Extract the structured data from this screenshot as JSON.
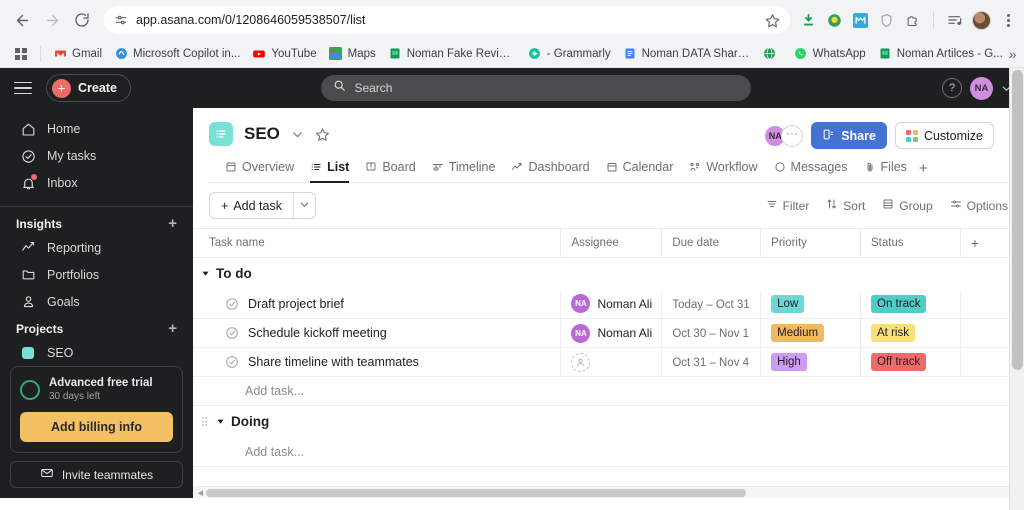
{
  "browser": {
    "back_icon": "back-arrow-icon",
    "forward_icon": "forward-arrow-icon",
    "reload_icon": "reload-icon",
    "url": "app.asana.com/0/1208646059538507/list",
    "site_settings_icon": "site-settings-icon",
    "bookmark_star_icon": "star-icon",
    "toolbar_icons": [
      "download-icon",
      "extension-green-icon",
      "extension-blue-icon",
      "shield-icon",
      "extension-outline-icon"
    ],
    "split_screen_icon": "split-screen-icon",
    "profile_icon": "profile-avatar",
    "menu_icon": "kebab-menu-icon",
    "apps_icon": "apps-grid-icon",
    "overflow_label": "»",
    "bookmarks": [
      {
        "label": "Gmail",
        "icon": "gmail-icon"
      },
      {
        "label": "Microsoft Copilot in...",
        "icon": "copilot-icon"
      },
      {
        "label": "YouTube",
        "icon": "youtube-icon"
      },
      {
        "label": "Maps",
        "icon": "maps-icon"
      },
      {
        "label": "Noman Fake Review...",
        "icon": "sheets-icon"
      },
      {
        "label": "- Grammarly",
        "icon": "grammarly-icon"
      },
      {
        "label": "Noman DATA Sharin...",
        "icon": "docs-icon"
      },
      {
        "label": "",
        "icon": "globe-icon"
      },
      {
        "label": "WhatsApp",
        "icon": "whatsapp-icon"
      },
      {
        "label": "Noman Artilces - G...",
        "icon": "sheets-icon"
      }
    ]
  },
  "topbar": {
    "menu_icon": "hamburger-menu-icon",
    "create_label": "Create",
    "search_placeholder": "Search",
    "search_icon": "search-icon",
    "help_label": "?",
    "avatar_initials": "NA"
  },
  "sidebar": {
    "items": [
      {
        "label": "Home",
        "icon": "home-icon"
      },
      {
        "label": "My tasks",
        "icon": "check-circle-icon"
      },
      {
        "label": "Inbox",
        "icon": "bell-icon",
        "badge": true
      }
    ],
    "insights": {
      "title": "Insights",
      "add_label": "+",
      "items": [
        {
          "label": "Reporting",
          "icon": "chart-line-icon"
        },
        {
          "label": "Portfolios",
          "icon": "folder-icon"
        },
        {
          "label": "Goals",
          "icon": "goal-icon"
        }
      ]
    },
    "projects": {
      "title": "Projects",
      "add_label": "+",
      "items": [
        {
          "label": "SEO",
          "icon": "project-dot-icon",
          "color": "#7ae0d3"
        }
      ]
    },
    "trial": {
      "title": "Advanced free trial",
      "subtitle": "30 days left",
      "billing_label": "Add billing info",
      "billing_color": "#f3c164"
    },
    "invite_label": "Invite teammates",
    "invite_icon": "envelope-icon"
  },
  "project": {
    "name": "SEO",
    "icon": "list-project-icon",
    "icon_color": "#7ae0d3",
    "chevron_icon": "chevron-down-icon",
    "star_icon": "star-outline-icon",
    "avatar_initials": "NA",
    "avatar_more": "···",
    "share_label": "Share",
    "share_icon": "share-icon",
    "share_color": "#4573d2",
    "customize_label": "Customize",
    "customize_icon": "customize-grid-icon",
    "tabs": [
      {
        "label": "Overview",
        "icon": "overview-icon",
        "active": false
      },
      {
        "label": "List",
        "icon": "list-icon",
        "active": true
      },
      {
        "label": "Board",
        "icon": "board-icon",
        "active": false
      },
      {
        "label": "Timeline",
        "icon": "timeline-icon",
        "active": false
      },
      {
        "label": "Dashboard",
        "icon": "dashboard-icon",
        "active": false
      },
      {
        "label": "Calendar",
        "icon": "calendar-icon",
        "active": false
      },
      {
        "label": "Workflow",
        "icon": "workflow-icon",
        "active": false
      },
      {
        "label": "Messages",
        "icon": "messages-icon",
        "active": false
      },
      {
        "label": "Files",
        "icon": "files-icon",
        "active": false
      }
    ],
    "tab_add_label": "+"
  },
  "toolbar": {
    "add_task_label": "Add task",
    "add_task_plus": "+",
    "add_task_caret_icon": "chevron-down-icon",
    "filter_label": "Filter",
    "filter_icon": "filter-icon",
    "sort_label": "Sort",
    "sort_icon": "sort-icon",
    "group_label": "Group",
    "group_icon": "group-icon",
    "options_label": "Options",
    "options_icon": "options-icon"
  },
  "table": {
    "columns": [
      "Task name",
      "Assignee",
      "Due date",
      "Priority",
      "Status"
    ],
    "add_column_label": "+",
    "groups": [
      {
        "name": "To do",
        "collapsed": false,
        "add_task_label": "Add task...",
        "rows": [
          {
            "task": "Draft project brief",
            "assignee": "Noman Ali",
            "assignee_initials": "NA",
            "due": "Today – Oct 31",
            "priority": "Low",
            "priority_color": "#6ed7d3",
            "status": "On track",
            "status_color": "#4ecdc8"
          },
          {
            "task": "Schedule kickoff meeting",
            "assignee": "Noman Ali",
            "assignee_initials": "NA",
            "due": "Oct 30 – Nov 1",
            "priority": "Medium",
            "priority_color": "#f1b860",
            "status": "At risk",
            "status_color": "#f7e07a"
          },
          {
            "task": "Share timeline with teammates",
            "assignee": "",
            "assignee_initials": "",
            "due": "Oct 31 – Nov 4",
            "priority": "High",
            "priority_color": "#cb9cf2",
            "status": "Off track",
            "status_color": "#f06a6a"
          }
        ]
      },
      {
        "name": "Doing",
        "collapsed": false,
        "add_task_label": "Add task...",
        "rows": []
      }
    ]
  }
}
